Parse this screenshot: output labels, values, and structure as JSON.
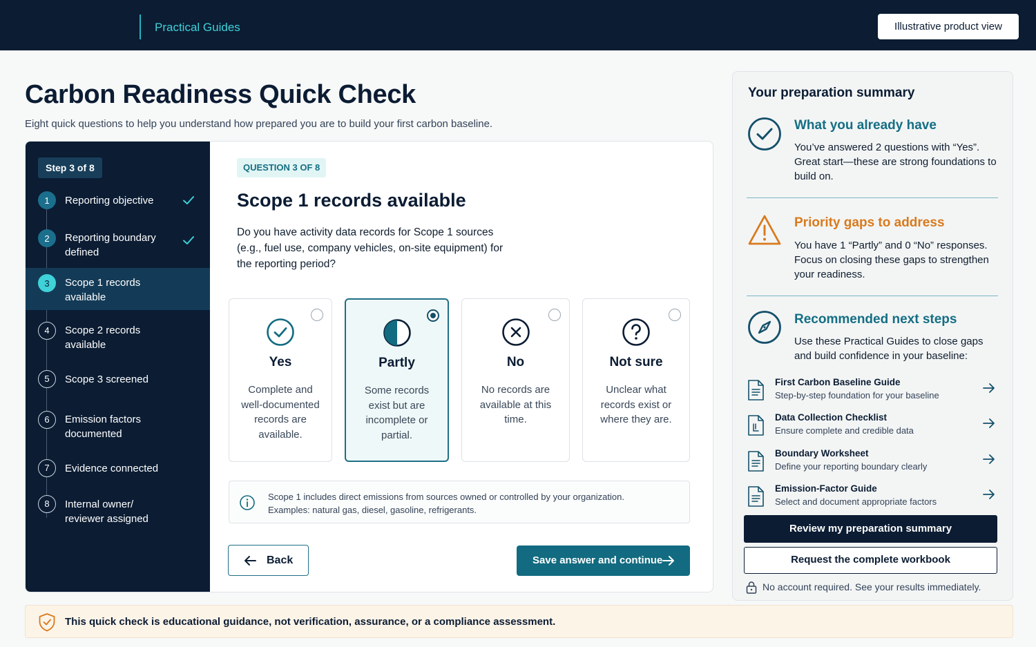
{
  "topbar": {
    "brand": "Practical Guides",
    "illustrative_label": "Illustrative product view"
  },
  "header": {
    "title": "Carbon Readiness Quick Check",
    "subtitle": "Eight quick questions to help you understand how prepared you are to build your first carbon baseline."
  },
  "stepper": {
    "progress_label": "Step 3 of 8",
    "steps": [
      {
        "num": "1",
        "label": "Reporting objective",
        "state": "done"
      },
      {
        "num": "2",
        "label": "Reporting boundary defined",
        "state": "done"
      },
      {
        "num": "3",
        "label": "Scope 1 records available",
        "state": "current"
      },
      {
        "num": "4",
        "label": "Scope 2 records available",
        "state": "todo"
      },
      {
        "num": "5",
        "label": "Scope 3 screened",
        "state": "todo"
      },
      {
        "num": "6",
        "label": "Emission factors documented",
        "state": "todo"
      },
      {
        "num": "7",
        "label": "Evidence connected",
        "state": "todo"
      },
      {
        "num": "8",
        "label": "Internal owner/ reviewer assigned",
        "state": "todo"
      }
    ]
  },
  "question": {
    "counter": "QUESTION 3 OF 8",
    "title": "Scope 1 records available",
    "text": "Do you have activity data records for Scope 1 sources (e.g., fuel use, company vehicles, on-site equipment) for the reporting period?",
    "options": [
      {
        "title": "Yes",
        "desc": "Complete and well-documented records are available.",
        "icon": "check-circle-icon",
        "selected": false
      },
      {
        "title": "Partly",
        "desc": "Some records exist but are incomplete or partial.",
        "icon": "half-circle-icon",
        "selected": true
      },
      {
        "title": "No",
        "desc": "No records are available at this time.",
        "icon": "x-circle-icon",
        "selected": false
      },
      {
        "title": "Not sure",
        "desc": "Unclear what records exist or where they are.",
        "icon": "question-circle-icon",
        "selected": false
      }
    ],
    "info": "Scope 1 includes direct emissions from sources owned or controlled by your organization. Examples: natural gas, diesel, gasoline, refrigerants.",
    "back_label": "Back",
    "save_label": "Save answer and continue"
  },
  "summary": {
    "title": "Your preparation summary",
    "have": {
      "title": "What you already have",
      "text": "You’ve answered 2 questions with “Yes”. Great start—these are strong foundations to build on."
    },
    "gaps": {
      "title": "Priority gaps to address",
      "text": "You have 1 “Partly” and 0 “No” responses. Focus on closing these gaps to strengthen your readiness."
    },
    "next": {
      "title": "Recommended next steps",
      "text": "Use these Practical Guides to close gaps and build confidence in your baseline:"
    },
    "guides": [
      {
        "title": "First Carbon Baseline Guide",
        "sub": "Step-by-step foundation for your baseline"
      },
      {
        "title": "Data Collection Checklist",
        "sub": "Ensure complete and credible data"
      },
      {
        "title": "Boundary Worksheet",
        "sub": "Define your reporting boundary clearly"
      },
      {
        "title": "Emission-Factor Guide",
        "sub": "Select and document appropriate factors"
      }
    ],
    "review_label": "Review my preparation summary",
    "request_label": "Request the complete workbook",
    "no_account": "No account required. See your results immediately."
  },
  "disclaimer": "This quick check is educational guidance, not verification, assurance, or a compliance assessment.",
  "colors": {
    "navy": "#0b1c33",
    "teal": "#126b80",
    "accent_cyan": "#3fd2d8",
    "green_title": "#146e84",
    "orange_title": "#d97a1c"
  }
}
